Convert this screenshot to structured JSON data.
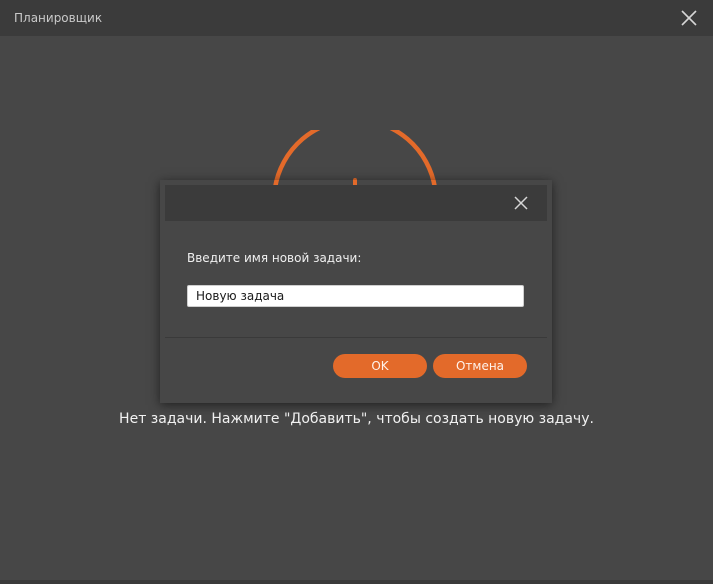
{
  "window": {
    "title": "Планировщик"
  },
  "main": {
    "empty_message": "Нет задачи. Нажмите \"Добавить\", чтобы создать новую задачу."
  },
  "dialog": {
    "prompt": "Введите имя новой задачи:",
    "task_name_value": "Новую задача",
    "ok_label": "OK",
    "cancel_label": "Отмена"
  },
  "colors": {
    "accent": "#e36a2a",
    "background": "#474747",
    "titlebar": "#3b3b3b"
  },
  "icons": {
    "window_close": "close-icon",
    "dialog_close": "close-icon",
    "illustration": "clock-icon"
  }
}
